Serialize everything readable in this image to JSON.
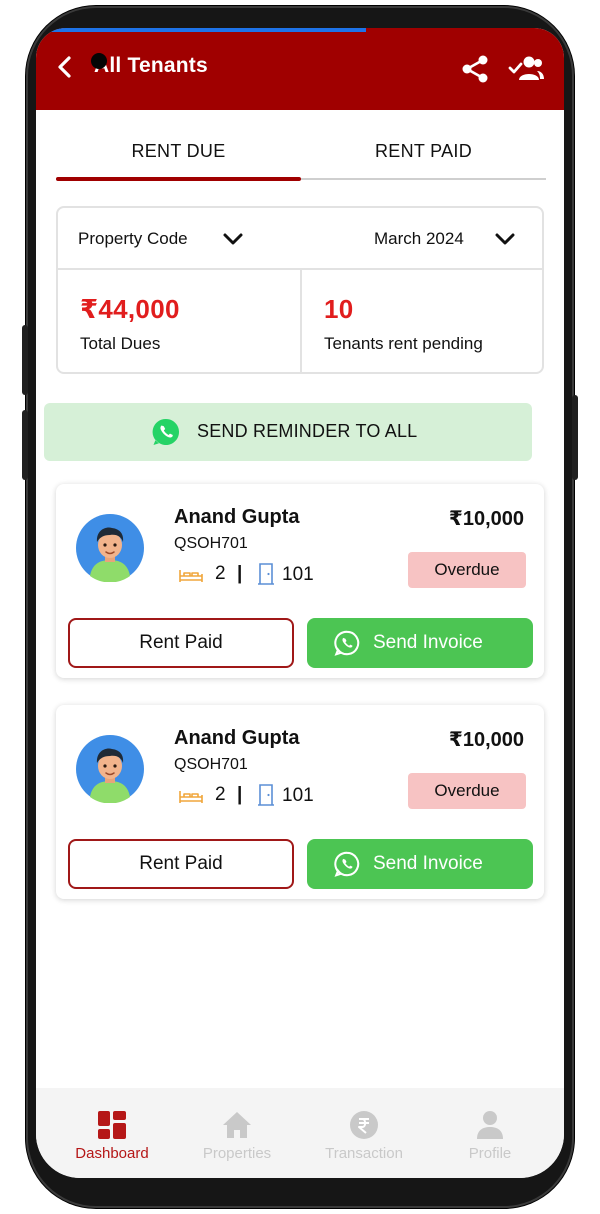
{
  "header": {
    "title": "All Tenants"
  },
  "tabs": [
    {
      "label": "RENT DUE"
    },
    {
      "label": "RENT PAID"
    }
  ],
  "filters": {
    "property": "Property Code",
    "month": "March 2024"
  },
  "summary": {
    "total_dues_value": "₹44,000",
    "total_dues_label": "Total Dues",
    "pending_value": "10",
    "pending_label": "Tenants rent pending"
  },
  "reminder": {
    "label": "SEND REMINDER TO ALL"
  },
  "tenants": [
    {
      "name": "Anand Gupta",
      "code": "QSOH701",
      "amount": "₹10,000",
      "beds": "2",
      "separator": "|",
      "room": "101",
      "status": "Overdue",
      "rent_paid_label": "Rent Paid",
      "invoice_label": "Send Invoice"
    },
    {
      "name": "Anand Gupta",
      "code": "QSOH701",
      "amount": "₹10,000",
      "beds": "2",
      "separator": "|",
      "room": "101",
      "status": "Overdue",
      "rent_paid_label": "Rent Paid",
      "invoice_label": "Send Invoice"
    }
  ],
  "nav": [
    {
      "label": "Dashboard",
      "icon": "dashboard-icon"
    },
    {
      "label": "Properties",
      "icon": "home-icon"
    },
    {
      "label": "Transaction",
      "icon": "rupee-icon"
    },
    {
      "label": "Profile",
      "icon": "profile-icon"
    }
  ],
  "colors": {
    "brand": "#a00000",
    "whatsapp": "#4cc553",
    "due_red": "#e11d1d",
    "overdue_bg": "#f7c3c3",
    "reminder_bg": "#d6f0d7"
  }
}
